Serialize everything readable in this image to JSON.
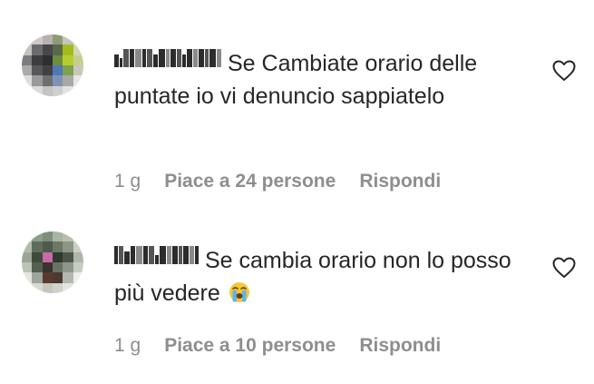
{
  "comments": [
    {
      "username": "p.vecinalucifer0",
      "text": "Se Cambiate orario delle puntate io vi denuncio sappiatelo",
      "time": "1 g",
      "likes": "Piace a 24 persone",
      "reply": "Rispondi",
      "avatar_colors": [
        "#d7d2cf",
        "#cfc9c9",
        "#b9b1b0",
        "#8f9a7b",
        "#c5c3bd",
        "#e2e0df",
        "#c6c2c1",
        "#6b6a6d",
        "#47464a",
        "#58694c",
        "#a4bb1c",
        "#d2d6b6",
        "#7c7c80",
        "#3d3d40",
        "#2e2e31",
        "#6e8e3d",
        "#b8cc2f",
        "#c6cf8e",
        "#aaaaad",
        "#575759",
        "#414144",
        "#4f78b5",
        "#7fa14e",
        "#c7c8b8",
        "#dcdcdc",
        "#9a9a9c",
        "#6f6f71",
        "#7e93b4",
        "#a8a8aa",
        "#e6e6e6",
        "#f0f0f0",
        "#dadada",
        "#c4c4c4",
        "#cfcfcf",
        "#e2e2e2",
        "#f4f4f4"
      ]
    },
    {
      "username": "nldoravelledi",
      "text": "Se cambia orario non lo posso più vedere",
      "emoji": "loudly-crying-face-icon",
      "time": "1 g",
      "likes": "Piace a 10 persone",
      "reply": "Rispondi",
      "avatar_colors": [
        "#c8cfc3",
        "#8e9e8a",
        "#7f8d7b",
        "#a9b3a0",
        "#b7c0b0",
        "#dfe3dc",
        "#b2bba9",
        "#5f6e5a",
        "#4e5a4a",
        "#6b7865",
        "#8b9683",
        "#cbd0c6",
        "#9aa595",
        "#3e4a3b",
        "#c86aa5",
        "#2f3a2e",
        "#4b5648",
        "#aeb6a8",
        "#bcc3b7",
        "#54604f",
        "#3a3330",
        "#6b7265",
        "#8e968a",
        "#c7ccc2",
        "#e3e6e0",
        "#9ea59a",
        "#5a3a30",
        "#4a3a32",
        "#b3b8ae",
        "#eceee9",
        "#f3f4f1",
        "#d7dbd3",
        "#c3c8be",
        "#cfd3ca",
        "#e4e6e1",
        "#f5f6f3"
      ]
    }
  ]
}
